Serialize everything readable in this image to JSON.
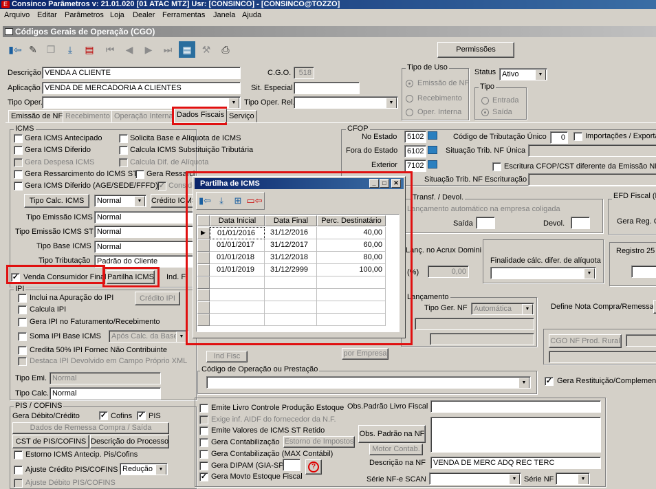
{
  "app": {
    "title": "Consinco Parâmetros  v: 21.01.020  [01 ATAC MTZ]  Usr: [CONSINCO] - [CONSINCO@TOZZO]",
    "logo": "E"
  },
  "menu": [
    "Arquivo",
    "Editar",
    "Parâmetros",
    "Loja",
    "Dealer",
    "Ferramentas",
    "Janela",
    "Ajuda"
  ],
  "window": {
    "title": "Códigos Gerais de Operação (CGO)"
  },
  "toolbar": {
    "permissoes": "Permissões"
  },
  "header": {
    "descricao_label": "Descrição",
    "descricao": "VENDA A CLIENTE",
    "aplicacao_label": "Aplicação",
    "aplicacao": "VENDA DE MERCADORIA A CLIENTES",
    "tipo_oper_label": "Tipo Oper.",
    "tipo_oper": "",
    "cgo_label": "C.G.O.",
    "cgo": "518",
    "sit_especial_label": "Sit. Especial",
    "sit_especial": "",
    "tipo_oper_rel_label": "Tipo Oper. Rel.",
    "tipo_oper_rel": "",
    "tipo_uso_title": "Tipo de Uso",
    "tipo_uso": [
      "Emissão de NF",
      "Recebimento",
      "Oper. Interna"
    ],
    "status_label": "Status",
    "status": "Ativo",
    "tipo_title": "Tipo",
    "tipo": [
      "Entrada",
      "Saída"
    ]
  },
  "tabs": [
    "Emissão de NF",
    "Recebimento",
    "Operação Interna",
    "Dados Fiscais",
    "Serviço"
  ],
  "icms": {
    "title": "ICMS",
    "checks": [
      "Gera ICMS Antecipado",
      "Gera ICMS Diferido",
      "Gera Despesa ICMS",
      "Gera Ressarcimento do ICMS ST",
      "Gera ICMS Diferido (AGE/SEDE/FFFD)"
    ],
    "checks2": [
      "Solicita Base e Alíquota de ICMS",
      "Calcula ICMS Substituição Tributária",
      "Calcula Dif. de Alíquota",
      "Gera Ressarcimento ICMS ST (PIS/COFINS)",
      "Considera"
    ],
    "tipo_calc_btn": "Tipo Calc. ICMS",
    "tipo_calc": "Normal",
    "credito_btn": "Crédito ICMS",
    "tipo_emissao_label": "Tipo Emissão ICMS",
    "tipo_emissao": "Normal",
    "tipo_emissao_st_label": "Tipo Emissão ICMS ST",
    "tipo_emissao_st": "Normal",
    "tipo_base_label": "Tipo Base ICMS",
    "tipo_base": "Normal",
    "tipo_trib_label": "Tipo Tributação",
    "tipo_trib": "Padrão do Cliente",
    "venda_consumidor": "Venda Consumidor Final",
    "partilha_btn": "Partilha ICMS",
    "ind_label": "Ind. F"
  },
  "ipi": {
    "title": "IPI",
    "checks": [
      "Inclui na Apuração do IPI",
      "Calcula IPI",
      "Gera IPI no Faturamento/Recebimento",
      "Soma IPI Base ICMS",
      "Credita 50% IPI Fornec Não Contribuinte",
      "Destaca IPI Devolvido em Campo Próprio XML"
    ],
    "credito_btn": "Crédito IPI",
    "apos_calc": "Após Calc. da Base",
    "tipo_emi_label": "Tipo Emi.",
    "tipo_emi": "Normal",
    "tipo_calc_label": "Tipo Calc.",
    "tipo_calc": "Normal"
  },
  "pis": {
    "title": "PIS / COFINS",
    "gera_label": "Gera Débito/Crédito",
    "cofins": "Cofins",
    "pis": "PIS",
    "dados_remessa": "Dados de Remessa Compra / Saída",
    "cst_btn": "CST de PIS/COFINS",
    "desc_proc_btn": "Descrição do Processo",
    "estorno": "Estorno ICMS Antecip. Pis/Cofins",
    "ajuste_cred": "Ajuste Crédito PIS/COFINS",
    "ajuste_cred_val": "Redução",
    "ajuste_deb": "Ajuste Débito PIS/COFINS"
  },
  "cfop": {
    "title": "CFOP",
    "no_estado_label": "No Estado",
    "no_estado": "5102",
    "fora_estado_label": "Fora do Estado",
    "fora_estado": "6102",
    "exterior_label": "Exterior",
    "exterior": "7102",
    "cod_trib_label": "Código de Tributação Único",
    "cod_trib": "0",
    "importacoes": "Importações / Exportações",
    "sit_trib_label": "Situação Trib. NF Única",
    "escritura": "Escritura CFOP/CST diferente da Emissão NF",
    "sit_trib_escr_label": "Situação Trib. NF Escrituração"
  },
  "right": {
    "transf_title": "Transf. / Devol.",
    "lanc_auto": "Lançamento automático na empresa coligada",
    "saida": "Saída",
    "devol": "Devol.",
    "efd_title": "EFD Fiscal (Registro",
    "gera_reg": "Gera Reg. C",
    "acrux": "Lanç. no Acrux Domini",
    "perc_label": "(%)",
    "perc": "0,00",
    "finalidade_title": "Finalidade cálc. difer. de alíquota",
    "registro25": "Registro 25",
    "lancamento_title": "Lançamento",
    "tipo_ger_label": "Tipo Ger. NF",
    "tipo_ger": "Automática",
    "define_nota": "Define Nota Compra/Remessa",
    "cgo_nf_btn": "CGO NF Prod. Rural",
    "ind_fisc_btn": "Ind Fisc",
    "por_empresa_btn": "por Empresa",
    "gera_restituicao": "Gera Restituição/Complemento"
  },
  "codop": {
    "title": "Código de Operação ou Prestação"
  },
  "bottom": {
    "checks": [
      "Emite Livro Controle Produção Estoque",
      "Exige inf. AIDF do fornecedor da N.F.",
      "Emite Valores de ICMS ST Retido",
      "Gera Contabilização",
      "Gera Contabilização (MAX Contábil)",
      "Gera DIPAM (GIA-SP)",
      "Gera Movto Estoque Fiscal"
    ],
    "estorno_btn": "Estorno de Impostos",
    "obs_label": "Obs.Padrão Livro Fiscal",
    "obs_btn": "Obs. Padrão na NF",
    "motor_btn": "Motor Contab.",
    "desc_nf_label": "Descrição na NF",
    "desc_nf": "VENDA DE MERC ADQ REC TERC",
    "serie_scan_label": "Série NF-e SCAN",
    "serie_nf_label": "Série NF"
  },
  "popup": {
    "title": "Partilha de ICMS",
    "columns": [
      "Data Inicial",
      "Data Final",
      "Perc. Destinatário"
    ],
    "rows": [
      [
        "01/01/2016",
        "31/12/2016",
        "40,00"
      ],
      [
        "01/01/2017",
        "31/12/2017",
        "60,00"
      ],
      [
        "01/01/2018",
        "31/12/2018",
        "80,00"
      ],
      [
        "01/01/2019",
        "31/12/2999",
        "100,00"
      ]
    ]
  }
}
